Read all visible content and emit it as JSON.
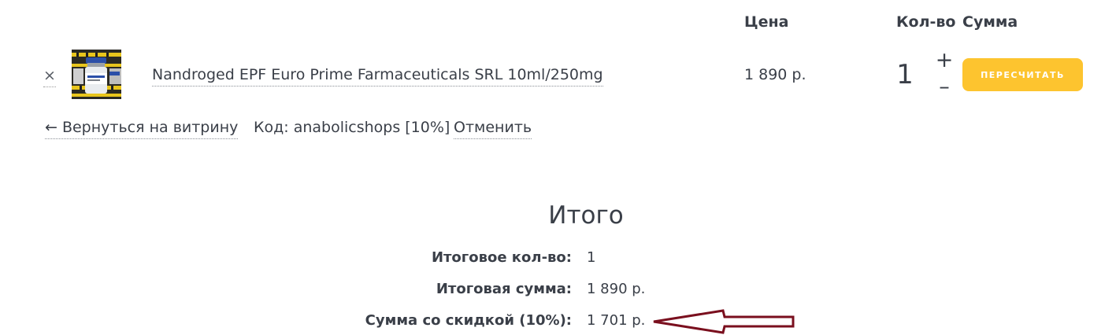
{
  "columns": {
    "price": "Цена",
    "qty": "Кол-во",
    "sum": "Сумма"
  },
  "item": {
    "remove_glyph": "×",
    "name": "Nandroged EPF Euro Prime Farmaceuticals SRL 10ml/250mg",
    "price": "1 890 р.",
    "quantity": "1",
    "plus": "+",
    "minus": "–",
    "thumbnail_icon": "vial-product-photo"
  },
  "actions": {
    "recalc_label": "ПЕРЕСЧИТАТЬ"
  },
  "back_link": "← Вернуться на витрину",
  "coupon": {
    "text": "Код: anabolicshops [10%]",
    "cancel_label": "Отменить"
  },
  "totals": {
    "title": "Итого",
    "rows": [
      {
        "label": "Итоговое кол-во:",
        "value": "1"
      },
      {
        "label": "Итоговая сумма:",
        "value": "1 890 р."
      },
      {
        "label": "Сумма со скидкой (10%):",
        "value": "1 701 р."
      }
    ]
  },
  "colors": {
    "accent": "#fdc42f",
    "arrow": "#7a0f1e",
    "text": "#3a3f48"
  }
}
